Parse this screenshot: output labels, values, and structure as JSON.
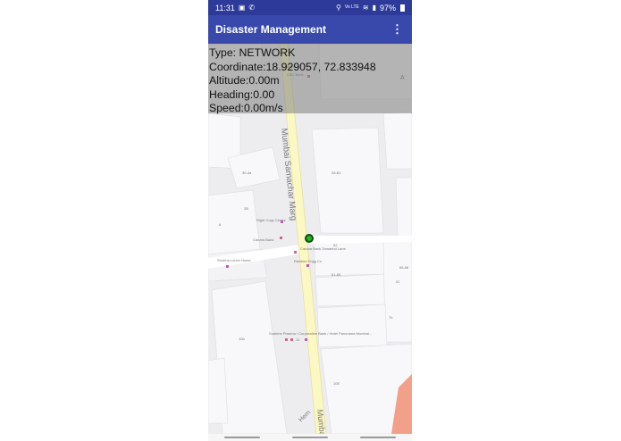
{
  "status_bar": {
    "time": "11:31",
    "battery": "97%",
    "network_text": "Vo LTE",
    "icons": [
      "gallery-icon",
      "phone-icon",
      "location-icon",
      "wifi-icon",
      "signal-icon",
      "battery-icon"
    ]
  },
  "app_bar": {
    "title": "Disaster Management",
    "menu_glyph": "⋮"
  },
  "location_info": {
    "type_line": "Type: NETWORK",
    "coordinate_line": "Coordinate:18.929057, 72.833948",
    "altitude_line": "Altitude:0.00m",
    "heading_line": "Heading:0.00",
    "speed_line": "Speed:0.00m/s"
  },
  "map": {
    "road_main": "Mumbai Samachar Marg",
    "road_bottom": "Mumbai",
    "road_bottom_left": "Hern",
    "places": {
      "poi_top_1": "CSC Bank",
      "poi_top_2": "Bank",
      "poi_a": "A",
      "poi_1": "Right Copy Centre",
      "poi_2": "Canara Bank",
      "poi_3": "Canara Bank Tamarind Lane",
      "poi_4": "Ravikiro Engg Co",
      "poi_5": "Shobha Lunch Home",
      "poi_6": "Sudhine Pharma / Corporation Bank / Hotel Panorama Mumbai...",
      "poi_7": "10",
      "b1": "30-4a",
      "b2": "28-B1",
      "b3": "2B",
      "b4": "6",
      "b5": "62",
      "b6": "61-66",
      "b7": "66-68",
      "b8": "22",
      "b9": "7b",
      "b10": "10b",
      "b11": "10E"
    },
    "colors": {
      "road_main": "#fbf8c3",
      "building": "#f8f8fb",
      "ground": "#ececef",
      "location": "#27b327"
    }
  }
}
